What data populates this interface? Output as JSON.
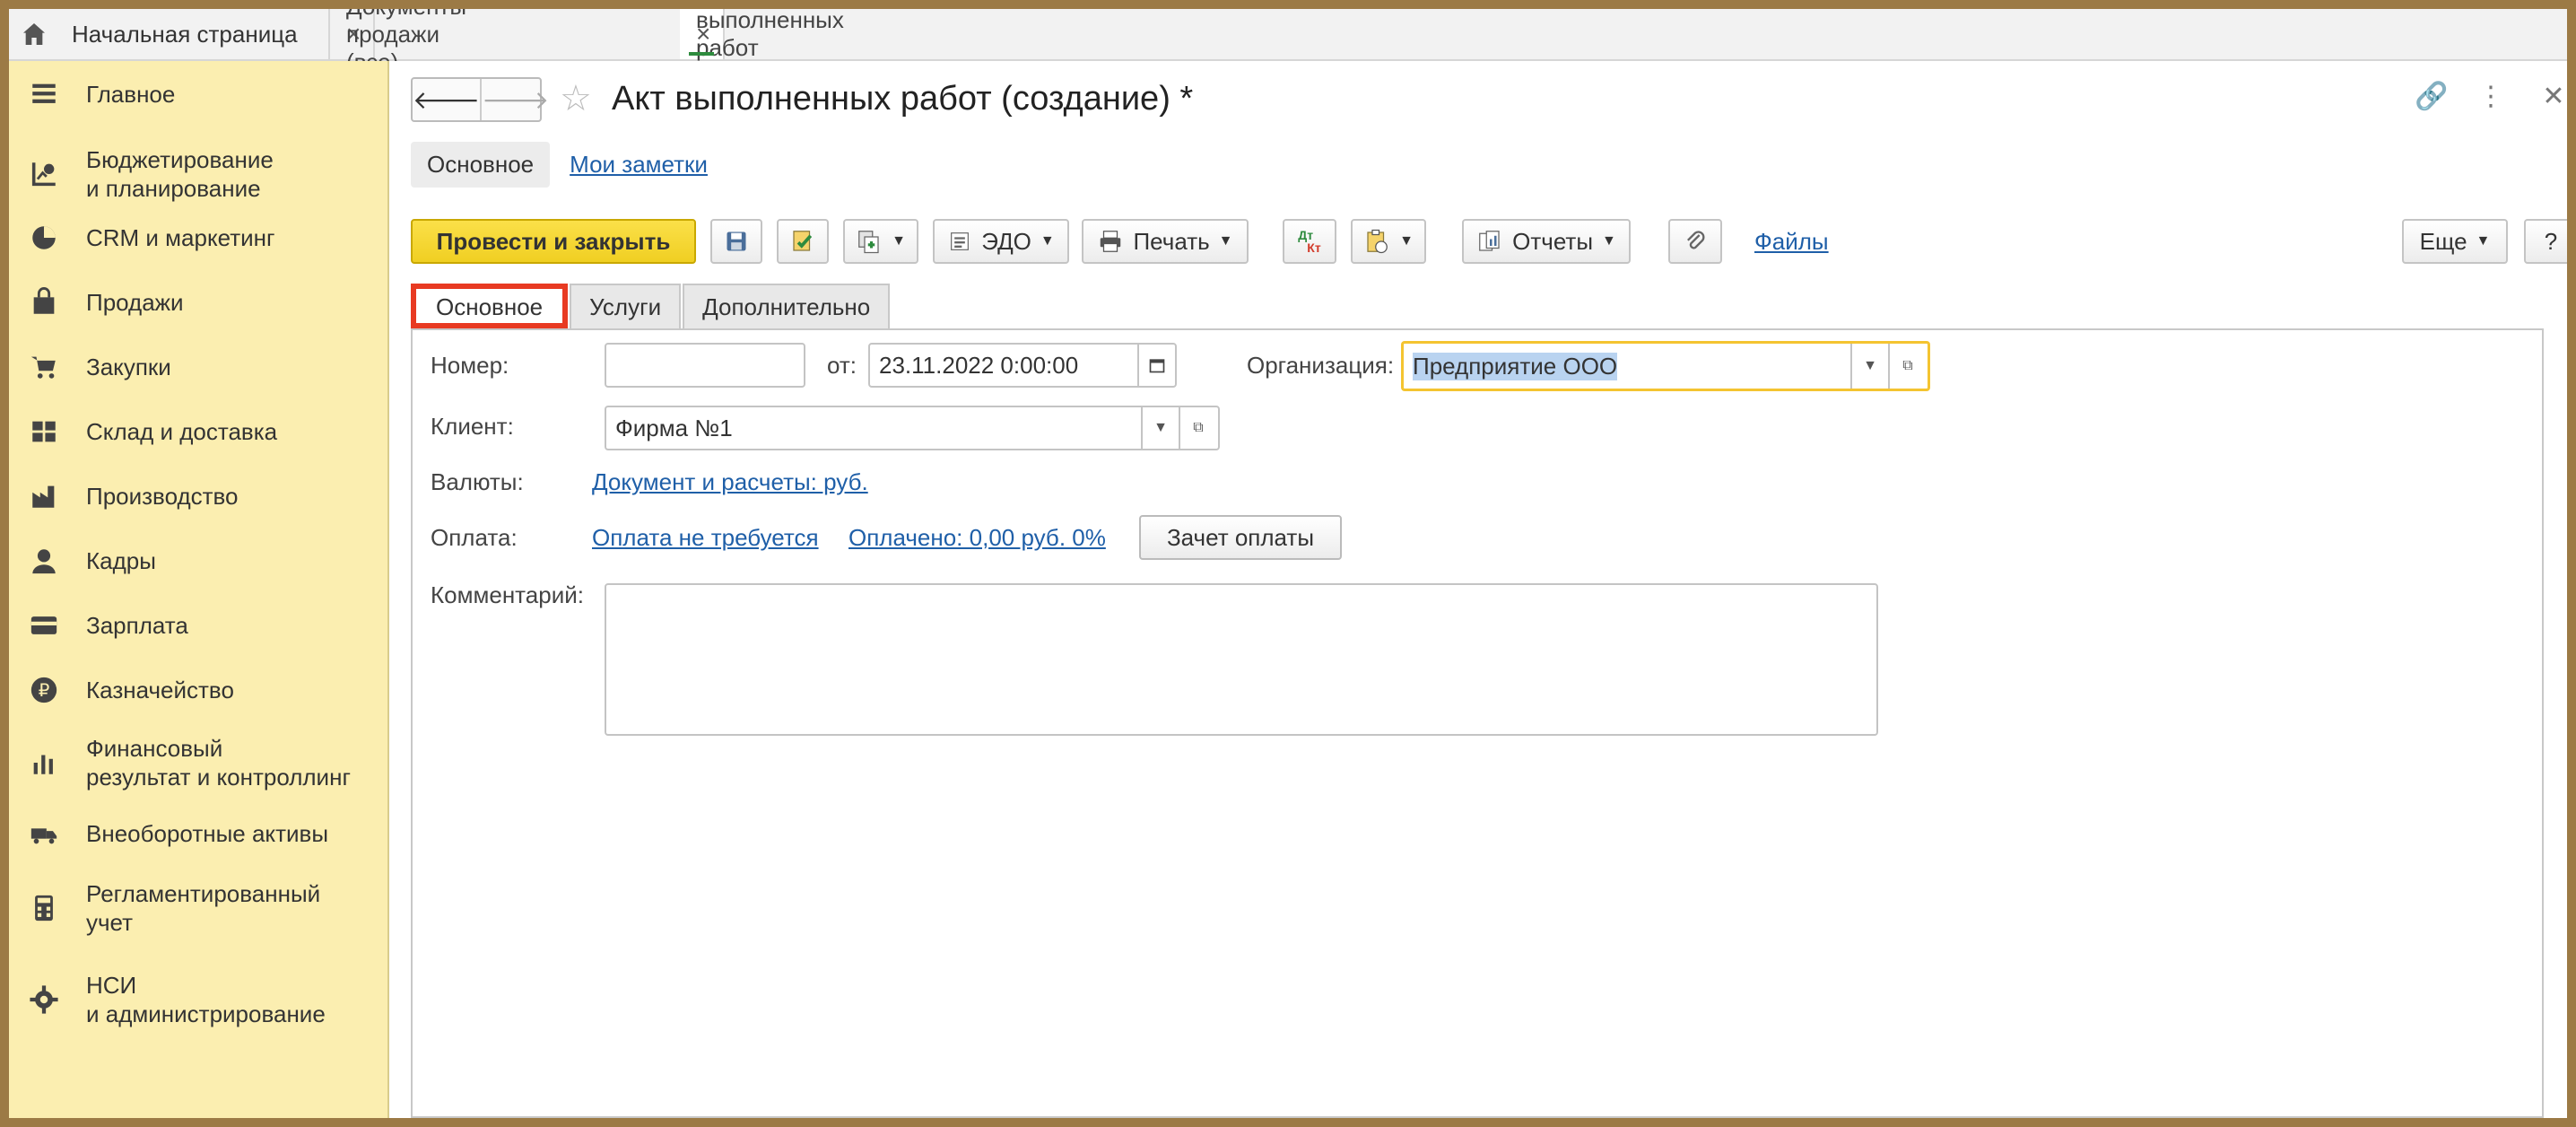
{
  "tabs": {
    "home": "Начальная страница",
    "items": [
      {
        "label": "Документы продажи (все)"
      },
      {
        "label": "Акт выполненных работ (создание) *"
      }
    ]
  },
  "sidebar": {
    "items": [
      {
        "label": "Главное",
        "icon": "menu-icon"
      },
      {
        "label": "Бюджетирование\nи планирование",
        "icon": "budget-icon"
      },
      {
        "label": "CRM и маркетинг",
        "icon": "pie-chart-icon"
      },
      {
        "label": "Продажи",
        "icon": "shopping-bag-icon"
      },
      {
        "label": "Закупки",
        "icon": "cart-icon"
      },
      {
        "label": "Склад и доставка",
        "icon": "warehouse-icon"
      },
      {
        "label": "Производство",
        "icon": "factory-icon"
      },
      {
        "label": "Кадры",
        "icon": "person-icon"
      },
      {
        "label": "Зарплата",
        "icon": "card-icon"
      },
      {
        "label": "Казначейство",
        "icon": "ruble-icon"
      },
      {
        "label": "Финансовый\nрезультат и контроллинг",
        "icon": "bar-chart-icon"
      },
      {
        "label": "Внеоборотные активы",
        "icon": "truck-icon"
      },
      {
        "label": "Регламентированный\nучет",
        "icon": "calculator-icon"
      },
      {
        "label": "НСИ\nи администрирование",
        "icon": "gear-icon"
      }
    ]
  },
  "header": {
    "title": "Акт выполненных работ (создание) *",
    "subnav_main": "Основное",
    "subnav_notes": "Мои заметки"
  },
  "toolbar": {
    "post_close": "Провести и закрыть",
    "edo": "ЭДО",
    "print": "Печать",
    "reports": "Отчеты",
    "files": "Файлы",
    "more": "Еще",
    "help": "?",
    "dtkt_top": "Дт",
    "dtkt_bottom": "Кт"
  },
  "form_tabs": [
    "Основное",
    "Услуги",
    "Дополнительно"
  ],
  "form": {
    "number_label": "Номер:",
    "number_value": "",
    "from_label": "от:",
    "date_value": "23.11.2022  0:00:00",
    "org_label": "Организация:",
    "org_value": "Предприятие ООО",
    "client_label": "Клиент:",
    "client_value": "Фирма №1",
    "currency_label": "Валюты:",
    "currency_link": "Документ и расчеты: руб.",
    "payment_label": "Оплата:",
    "payment_link1": "Оплата не требуется",
    "payment_link2": "Оплачено: 0,00 руб. 0%",
    "offset_button": "Зачет оплаты",
    "comment_label": "Комментарий:",
    "comment_value": ""
  },
  "colors": {
    "sidebar_bg": "#fbeeb0",
    "primary_button": "#f0cf22",
    "link": "#1f5fa8",
    "active_tab_outline": "#e83a22",
    "focus_border": "#f4c431",
    "active_tab_underline": "#2e8b3e"
  }
}
